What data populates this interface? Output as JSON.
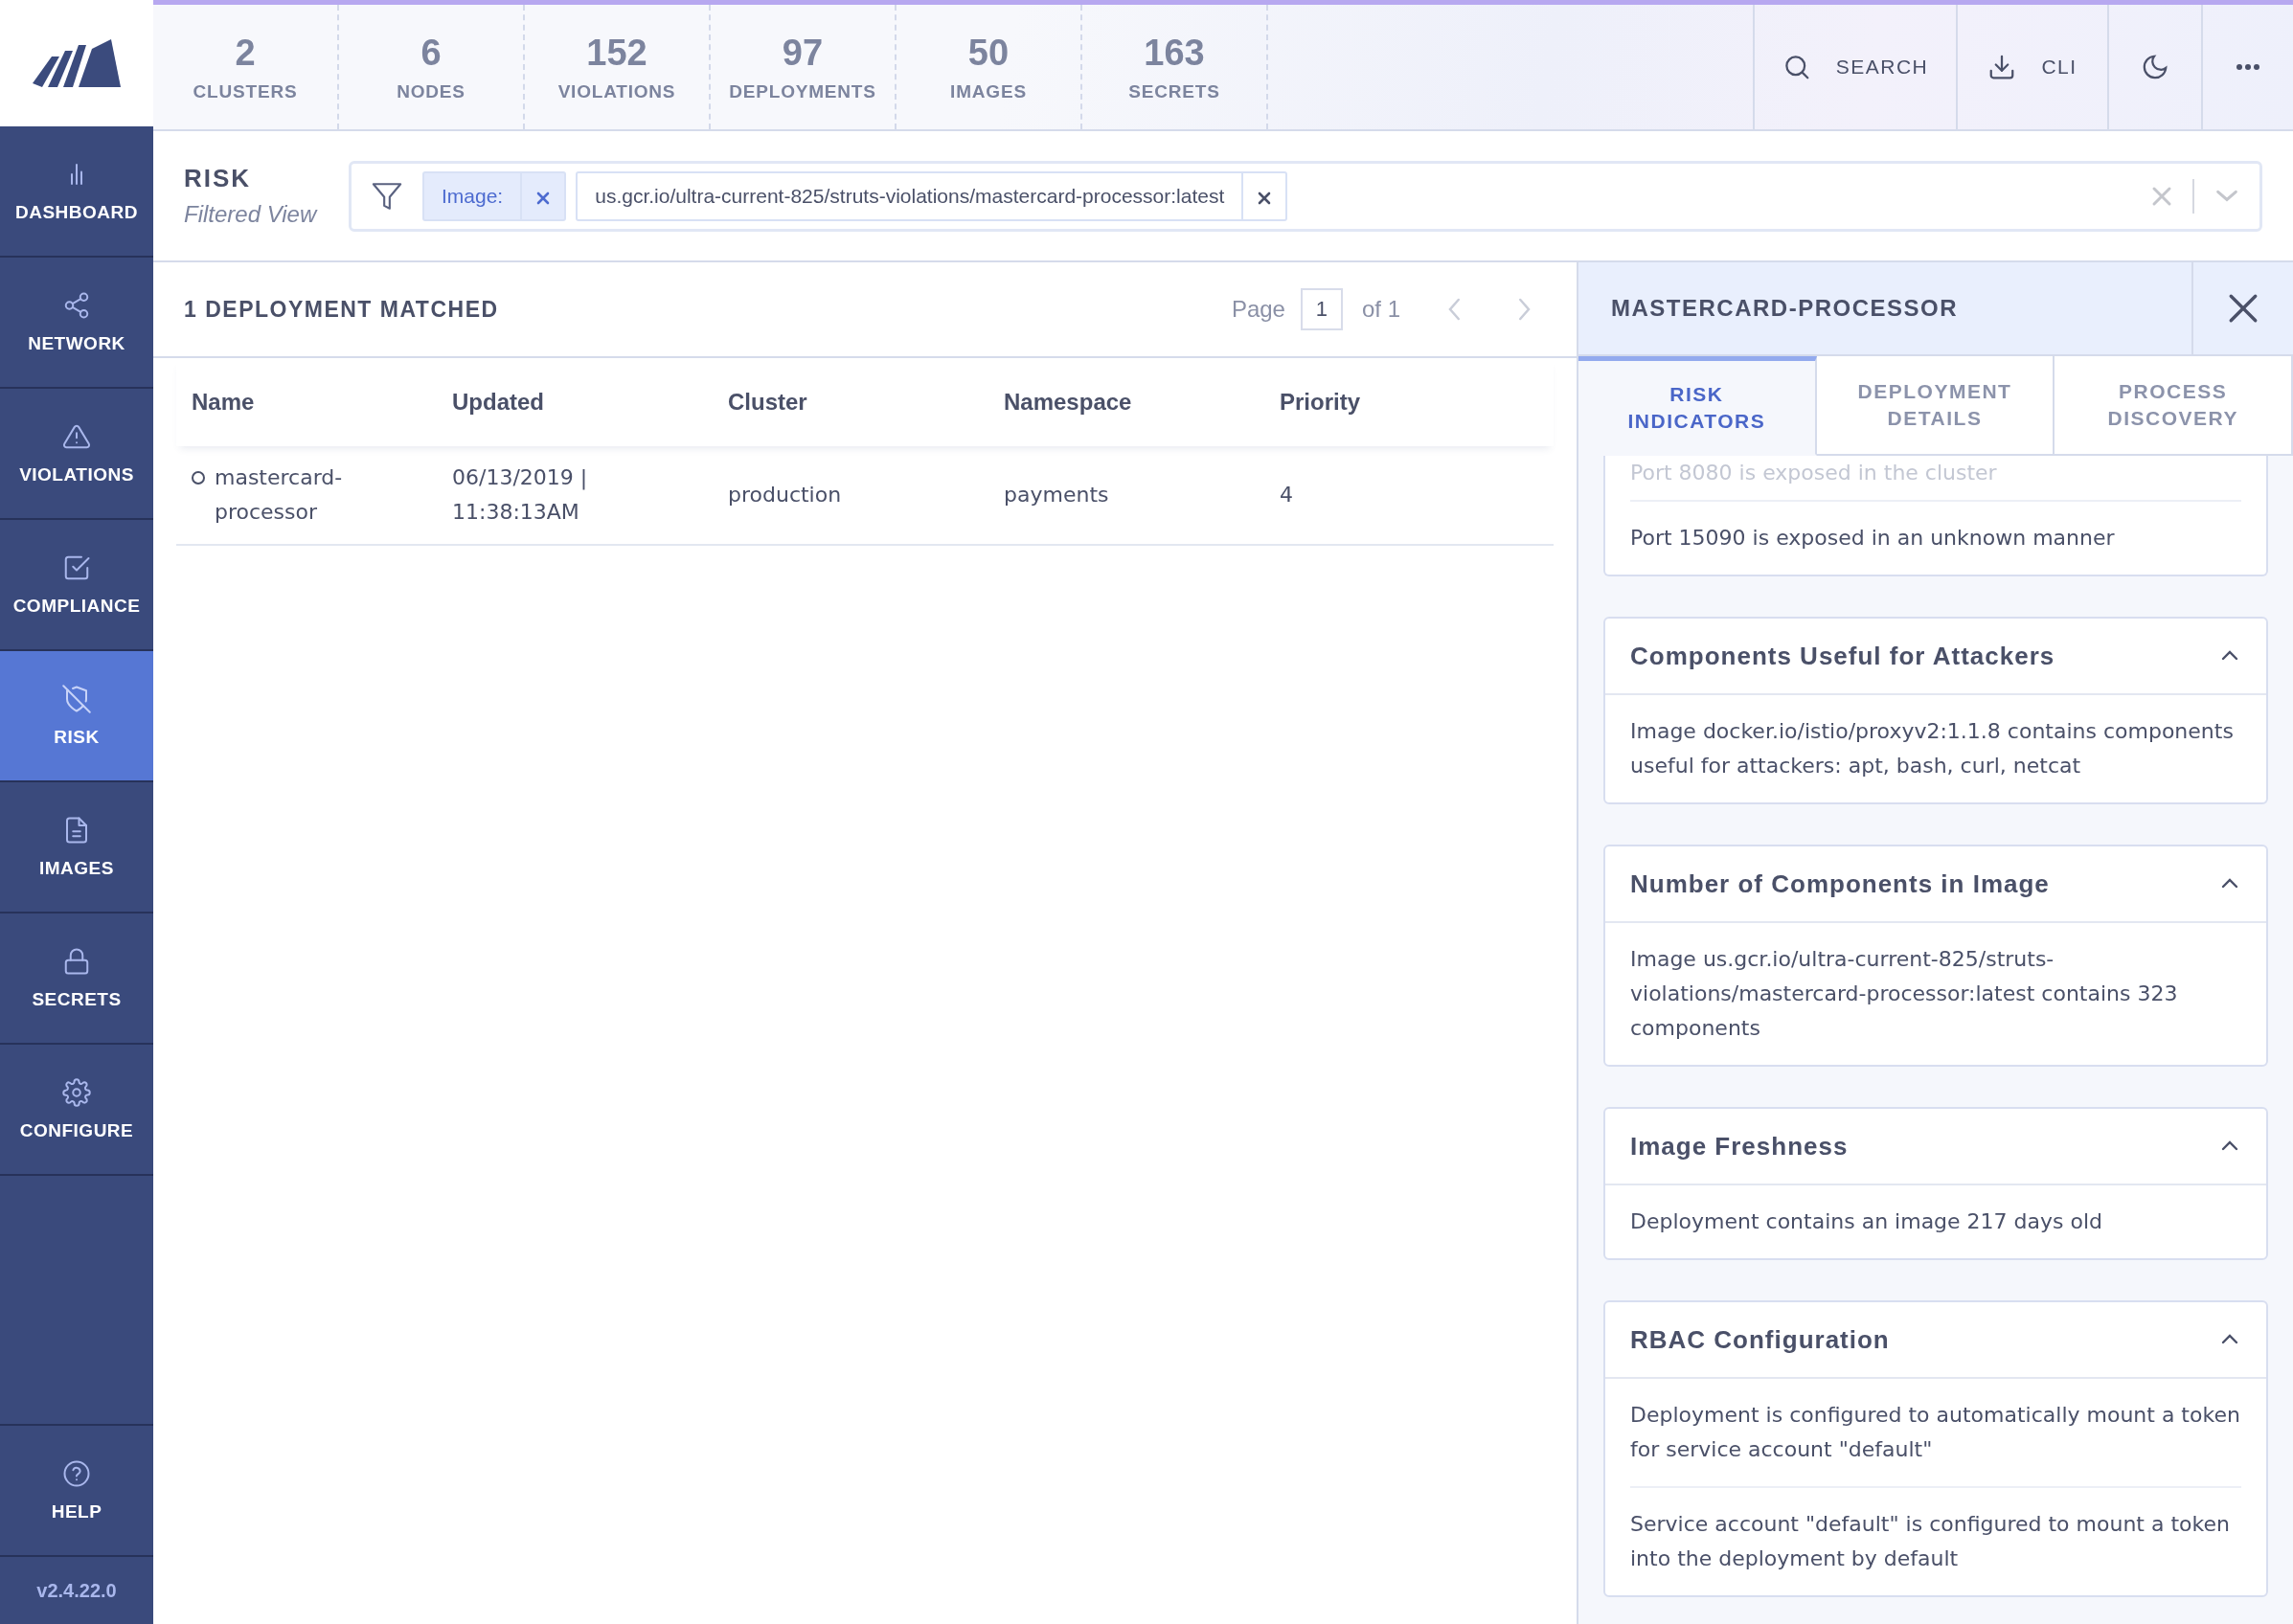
{
  "stats": [
    {
      "value": "2",
      "label": "CLUSTERS"
    },
    {
      "value": "6",
      "label": "NODES"
    },
    {
      "value": "152",
      "label": "VIOLATIONS"
    },
    {
      "value": "97",
      "label": "DEPLOYMENTS"
    },
    {
      "value": "50",
      "label": "IMAGES"
    },
    {
      "value": "163",
      "label": "SECRETS"
    }
  ],
  "header_actions": [
    {
      "kind": "search",
      "label": "SEARCH"
    },
    {
      "kind": "cli",
      "label": "CLI"
    },
    {
      "kind": "theme"
    },
    {
      "kind": "more"
    }
  ],
  "sidebar": {
    "items": [
      {
        "kind": "dashboard",
        "label": "DASHBOARD",
        "selected": false
      },
      {
        "kind": "network",
        "label": "NETWORK",
        "selected": false
      },
      {
        "kind": "violations",
        "label": "VIOLATIONS",
        "selected": false
      },
      {
        "kind": "compliance",
        "label": "COMPLIANCE",
        "selected": false
      },
      {
        "kind": "risk",
        "label": "RISK",
        "selected": true
      },
      {
        "kind": "images",
        "label": "IMAGES",
        "selected": false
      },
      {
        "kind": "secrets",
        "label": "SECRETS",
        "selected": false
      },
      {
        "kind": "configure",
        "label": "CONFIGURE",
        "selected": false
      }
    ],
    "help": {
      "label": "HELP"
    },
    "version": "v2.4.22.0"
  },
  "page": {
    "title": "RISK",
    "subtitle": "Filtered View"
  },
  "filter": {
    "chips": [
      {
        "kind": "category",
        "text": "Image:"
      },
      {
        "kind": "value",
        "text": "us.gcr.io/ultra-current-825/struts-violations/mastercard-processor:latest"
      }
    ]
  },
  "results": {
    "count_label": "1 DEPLOYMENT MATCHED",
    "page_label": "Page",
    "page": "1",
    "of_label": "of 1"
  },
  "table": {
    "columns": [
      "Name",
      "Updated",
      "Cluster",
      "Namespace",
      "Priority"
    ],
    "rows": [
      {
        "cells": [
          "mastercard-processor",
          "06/13/2019 | 11:38:13AM",
          "production",
          "payments",
          "4"
        ]
      }
    ]
  },
  "panel": {
    "title": "MASTERCARD-PROCESSOR",
    "tabs": [
      {
        "label": "RISK INDICATORS",
        "selected": true
      },
      {
        "label": "DEPLOYMENT DETAILS",
        "selected": false
      },
      {
        "label": "PROCESS DISCOVERY",
        "selected": false
      }
    ],
    "sections": [
      {
        "items": [
          "Port 8080 is exposed in the cluster",
          "Port 15090 is exposed in an unknown manner"
        ]
      },
      {
        "title": "Components Useful for Attackers",
        "expanded": true,
        "items": [
          "Image docker.io/istio/proxyv2:1.1.8 contains components useful for attackers: apt, bash, curl, netcat"
        ]
      },
      {
        "title": "Number of Components in Image",
        "expanded": true,
        "items": [
          "Image us.gcr.io/ultra-current-825/struts-violations/mastercard-processor:latest contains 323 components"
        ]
      },
      {
        "title": "Image Freshness",
        "expanded": true,
        "items": [
          "Deployment contains an image 217 days old"
        ]
      },
      {
        "title": "RBAC Configuration",
        "expanded": true,
        "items": [
          "Deployment is configured to automatically mount a token for service account \"default\"",
          "Service account \"default\" is configured to mount a token into the deployment by default"
        ]
      }
    ]
  }
}
